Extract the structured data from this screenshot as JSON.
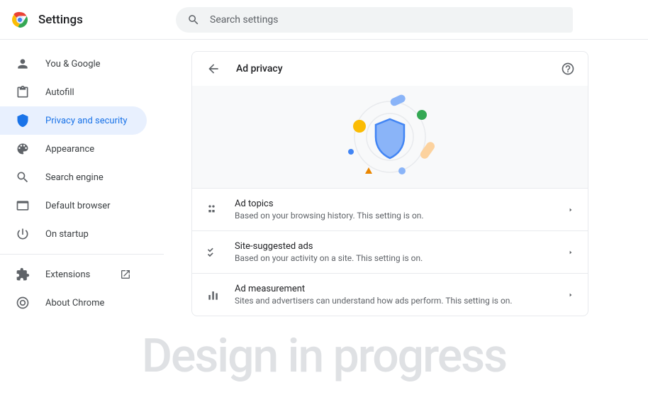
{
  "header": {
    "title": "Settings",
    "search_placeholder": "Search settings"
  },
  "sidebar": {
    "items": [
      {
        "icon": "person",
        "label": "You & Google"
      },
      {
        "icon": "clipboard",
        "label": "Autofill"
      },
      {
        "icon": "shield",
        "label": "Privacy and security"
      },
      {
        "icon": "palette",
        "label": "Appearance"
      },
      {
        "icon": "search",
        "label": "Search engine"
      },
      {
        "icon": "browser",
        "label": "Default browser"
      },
      {
        "icon": "power",
        "label": "On startup"
      }
    ],
    "extensions_label": "Extensions",
    "about_label": "About Chrome"
  },
  "card": {
    "title": "Ad privacy",
    "rows": [
      {
        "title": "Ad topics",
        "sub": "Based on your browsing history. This setting is on."
      },
      {
        "title": "Site-suggested ads",
        "sub": "Based on your activity on a site. This setting is on."
      },
      {
        "title": "Ad measurement",
        "sub": "Sites and advertisers can understand how ads perform. This setting is on."
      }
    ]
  },
  "watermark": "Design in progress"
}
